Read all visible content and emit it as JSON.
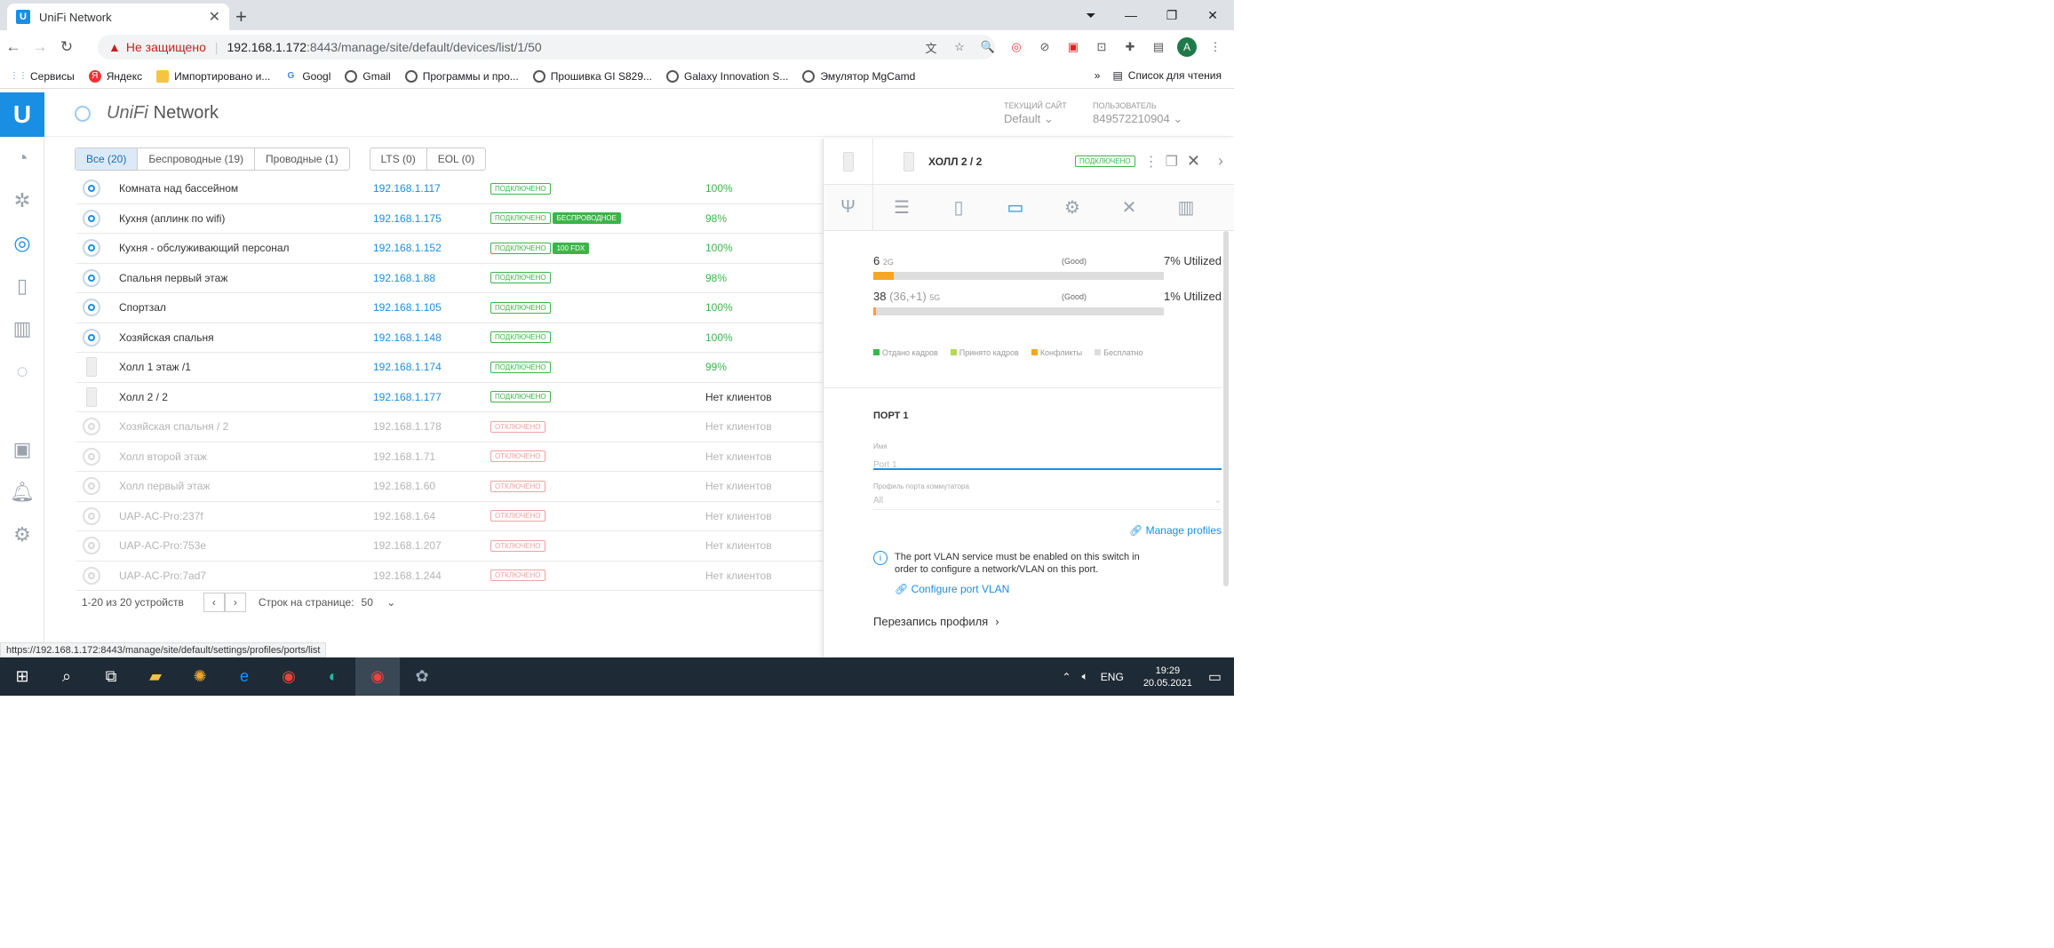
{
  "browser": {
    "tab_title": "UniFi Network",
    "not_secure": "Не защищено",
    "url_host": "192.168.1.172",
    "url_rest": ":8443/manage/site/default/devices/list/1/50",
    "avatar": "A",
    "bookmarks": [
      "Сервисы",
      "Яндекс",
      "Импортировано и...",
      "Googl",
      "Gmail",
      "Программы и про...",
      "Прошивка GI S829...",
      "Galaxy Innovation S...",
      "Эмулятор MgCamd"
    ],
    "reading_list": "Список для чтения",
    "status_url": "https://192.168.1.172:8443/manage/site/default/settings/profiles/ports/list"
  },
  "app": {
    "brand": "UniFi Network",
    "brand_uni": "UniFi",
    "brand_net": "Network",
    "site_label": "ТЕКУЩИЙ САЙТ",
    "site_value": "Default",
    "user_label": "ПОЛЬЗОВАТЕЛЬ",
    "user_value": "849572210904"
  },
  "filters": {
    "all": "Все (20)",
    "wireless": "Беспроводные (19)",
    "wired": "Проводные (1)",
    "lts": "LTS (0)",
    "eol": "EOL (0)"
  },
  "devices": [
    {
      "name": "Комната над бассейном",
      "ip": "192.168.1.117",
      "status": "ПОДКЛЮЧЕНО",
      "extra": "",
      "exp": "100%",
      "type": "ap",
      "off": false
    },
    {
      "name": "Кухня (аплинк по wifi)",
      "ip": "192.168.1.175",
      "status": "ПОДКЛЮЧЕНО",
      "extra": "БЕСПРОВОДНОЕ",
      "exp": "98%",
      "type": "ap",
      "off": false
    },
    {
      "name": "Кухня - обслуживающий персонал",
      "ip": "192.168.1.152",
      "status": "ПОДКЛЮЧЕНО",
      "extra": "100 FDX",
      "exp": "100%",
      "type": "ap",
      "off": false
    },
    {
      "name": "Спальня первый этаж",
      "ip": "192.168.1.88",
      "status": "ПОДКЛЮЧЕНО",
      "extra": "",
      "exp": "98%",
      "type": "ap",
      "off": false
    },
    {
      "name": "Спортзал",
      "ip": "192.168.1.105",
      "status": "ПОДКЛЮЧЕНО",
      "extra": "",
      "exp": "100%",
      "type": "ap",
      "off": false
    },
    {
      "name": "Хозяйская спальня",
      "ip": "192.168.1.148",
      "status": "ПОДКЛЮЧЕНО",
      "extra": "",
      "exp": "100%",
      "type": "ap",
      "off": false
    },
    {
      "name": "Холл 1 этаж /1",
      "ip": "192.168.1.174",
      "status": "ПОДКЛЮЧЕНО",
      "extra": "",
      "exp": "99%",
      "type": "wall",
      "off": false
    },
    {
      "name": "Холл 2 / 2",
      "ip": "192.168.1.177",
      "status": "ПОДКЛЮЧЕНО",
      "extra": "",
      "exp": "Нет клиентов",
      "type": "wall",
      "off": false
    },
    {
      "name": "Хозяйская спальня / 2",
      "ip": "192.168.1.178",
      "status": "ОТКЛЮЧЕНО",
      "extra": "",
      "exp": "Нет клиентов",
      "type": "ap",
      "off": true
    },
    {
      "name": "Холл второй этаж",
      "ip": "192.168.1.71",
      "status": "ОТКЛЮЧЕНО",
      "extra": "",
      "exp": "Нет клиентов",
      "type": "ap",
      "off": true
    },
    {
      "name": "Холл первый этаж",
      "ip": "192.168.1.60",
      "status": "ОТКЛЮЧЕНО",
      "extra": "",
      "exp": "Нет клиентов",
      "type": "ap",
      "off": true
    },
    {
      "name": "UAP-AC-Pro:237f",
      "ip": "192.168.1.64",
      "status": "ОТКЛЮЧЕНО",
      "extra": "",
      "exp": "Нет клиентов",
      "type": "ap",
      "off": true
    },
    {
      "name": "UAP-AC-Pro:753e",
      "ip": "192.168.1.207",
      "status": "ОТКЛЮЧЕНО",
      "extra": "",
      "exp": "Нет клиентов",
      "type": "ap",
      "off": true
    },
    {
      "name": "UAP-AC-Pro:7ad7",
      "ip": "192.168.1.244",
      "status": "ОТКЛЮЧЕНО",
      "extra": "",
      "exp": "Нет клиентов",
      "type": "ap",
      "off": true
    }
  ],
  "pager": {
    "count": "1-20 из 20 устройств",
    "rows_label": "Строк на странице:",
    "rows_value": "50"
  },
  "panel": {
    "title": "ХОЛЛ 2 / 2",
    "status": "ПОДКЛЮЧЕНО",
    "ch2_num": "6",
    "ch2_band": "2G",
    "ch2_quality": "(Good)",
    "ch2_util": "7% Utilized",
    "ch2_level": 0.07,
    "ch5_num": "38",
    "ch5_sub": "(36,+1)",
    "ch5_band": "5G",
    "ch5_quality": "(Good)",
    "ch5_util": "1% Utilized",
    "ch5_level": 0.01,
    "legend": [
      "Отдано кадров",
      "Принято кадров",
      "Конфликты",
      "Бесплатно"
    ],
    "legend_colors": [
      "#3bb54a",
      "#b6d957",
      "#f5a623",
      "#dddddd"
    ],
    "port_title": "ПОРТ 1",
    "name_label": "Имя",
    "name_placeholder": "Port 1",
    "profile_label": "Профиль порта коммутатора",
    "profile_value": "All",
    "manage_profiles": "Manage profiles",
    "info_text": "The port VLAN service must be enabled on this switch in order to configure a network/VLAN on this port.",
    "configure_vlan": "Configure port VLAN",
    "override": "Перезапись профиля"
  },
  "taskbar": {
    "lang": "ENG",
    "time": "19:29",
    "date": "20.05.2021"
  }
}
